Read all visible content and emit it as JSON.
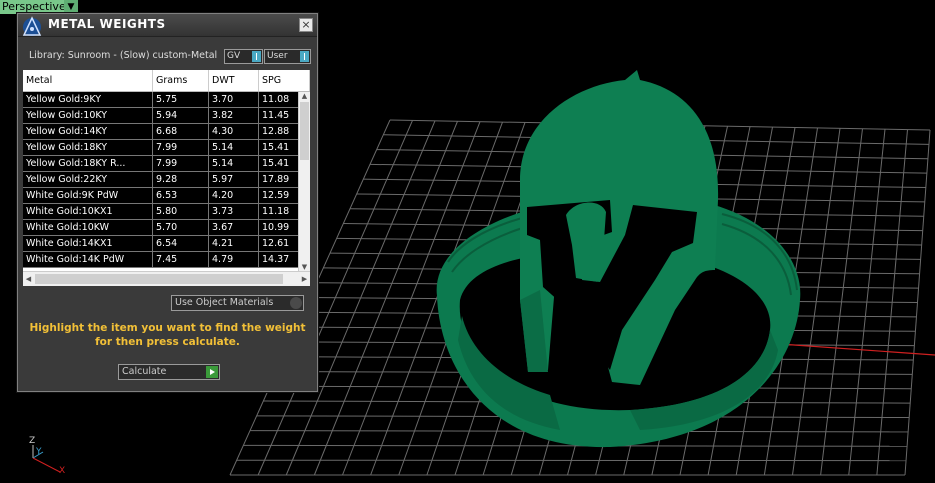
{
  "viewport": {
    "label": "Perspective",
    "dropdown_icon": "chevron-down-icon"
  },
  "panel": {
    "title": "METAL WEIGHTS",
    "library": "Library: Sunroom - (Slow) custom-Metal",
    "gv_label": "GV",
    "user_label": "User",
    "columns": [
      "Metal",
      "Grams",
      "DWT",
      "SPG"
    ],
    "rows": [
      [
        "Yellow Gold:9KY",
        "5.75",
        "3.70",
        "11.08"
      ],
      [
        "Yellow Gold:10KY",
        "5.94",
        "3.82",
        "11.45"
      ],
      [
        "Yellow Gold:14KY",
        "6.68",
        "4.30",
        "12.88"
      ],
      [
        "Yellow Gold:18KY",
        "7.99",
        "5.14",
        "15.41"
      ],
      [
        "Yellow Gold:18KY R...",
        "7.99",
        "5.14",
        "15.41"
      ],
      [
        "Yellow Gold:22KY",
        "9.28",
        "5.97",
        "17.89"
      ],
      [
        "White Gold:9K PdW",
        "6.53",
        "4.20",
        "12.59"
      ],
      [
        "White Gold:10KX1",
        "5.80",
        "3.73",
        "11.18"
      ],
      [
        "White Gold:10KW",
        "5.70",
        "3.67",
        "10.99"
      ],
      [
        "White Gold:14KX1",
        "6.54",
        "4.21",
        "12.61"
      ],
      [
        "White Gold:14K PdW",
        "7.45",
        "4.79",
        "14.37"
      ]
    ],
    "use_object_materials": "Use Object Materials",
    "message_line1": "Highlight the item you want to find the weight",
    "message_line2": "for then press calculate.",
    "calculate_label": "Calculate"
  },
  "axis": {
    "z": "Z",
    "y": "Y",
    "x": "X"
  },
  "colors": {
    "model": "#0c7a4f",
    "grid": "#6a6a6a",
    "panel_bg": "#3a3a3a",
    "message": "#f2c037"
  }
}
